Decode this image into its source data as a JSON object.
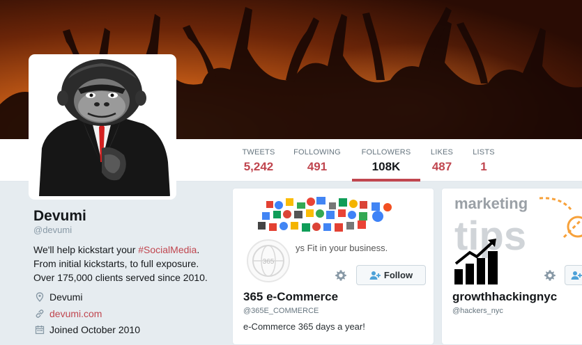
{
  "profile": {
    "name": "Devumi",
    "handle": "@devumi",
    "bio_line1": "We'll help kickstart your ",
    "bio_hashtag": "#SocialMedia",
    "bio_line1_end": ".",
    "bio_line2": "From initial kickstarts, to full exposure.",
    "bio_line3": "Over 175,000 clients served since 2010.",
    "location": "Devumi",
    "website": "devumi.com",
    "joined": "Joined October 2010"
  },
  "stats": [
    {
      "label": "TWEETS",
      "value": "5,242"
    },
    {
      "label": "FOLLOWING",
      "value": "491"
    },
    {
      "label": "FOLLOWERS",
      "value": "108K"
    },
    {
      "label": "LIKES",
      "value": "487"
    },
    {
      "label": "LISTS",
      "value": "1"
    }
  ],
  "cards": [
    {
      "name": "365 e-Commerce",
      "handle": "@365E_COMMERCE",
      "bio": "e-Commerce 365 days a year!",
      "banner_text": "ys Fit in your business.",
      "follow_label": "Follow"
    },
    {
      "name": "growthhackingnyc",
      "handle": "@hackers_nyc",
      "banner_text_1": "marketing",
      "banner_text_2": "tips"
    }
  ],
  "colors": {
    "accent": "#c0464f",
    "background": "#e6ecf0",
    "text": "#14171a",
    "muted": "#66757f"
  },
  "icons": [
    "location-pin-icon",
    "link-icon",
    "calendar-icon",
    "gear-icon",
    "add-user-icon"
  ]
}
